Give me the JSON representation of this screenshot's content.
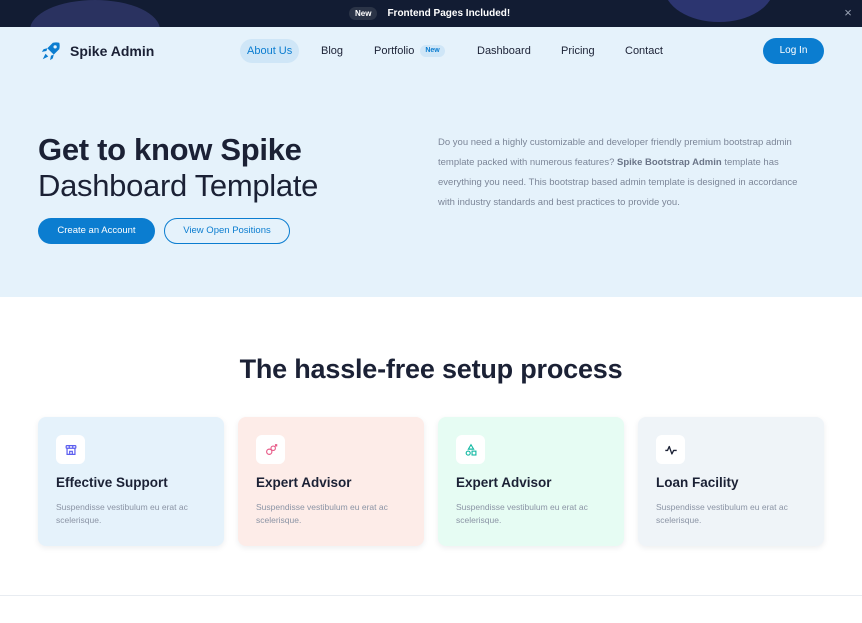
{
  "announcement": {
    "badge": "New",
    "message": "Frontend Pages Included!",
    "close_icon": "×"
  },
  "brand": {
    "name": "Spike Admin",
    "icon": "rocket-icon",
    "color": "#0b7dd0"
  },
  "nav": {
    "items": [
      {
        "label": "About Us",
        "active": true
      },
      {
        "label": "Blog"
      },
      {
        "label": "Portfolio",
        "badge": "New"
      },
      {
        "label": "Dashboard"
      },
      {
        "label": "Pricing"
      },
      {
        "label": "Contact"
      }
    ],
    "login_label": "Log In"
  },
  "hero": {
    "title_line1": "Get to know Spike",
    "title_line2": "Dashboard Template",
    "primary_button": "Create an Account",
    "secondary_button": "View Open Positions",
    "desc_part1": "Do you need a highly customizable and developer friendly premium bootstrap admin template packed with numerous features? ",
    "desc_bold": "Spike Bootstrap Admin",
    "desc_part2": " template has everything you need. This bootstrap based admin template is designed in accordance with industry standards and best practices to provide you."
  },
  "section": {
    "title": "The hassle-free setup process",
    "cards": [
      {
        "title": "Effective Support",
        "desc": "Suspendisse vestibulum eu erat ac scelerisque.",
        "icon": "store-icon",
        "bg": "#e5f2fb",
        "icon_color": "#5d5fef"
      },
      {
        "title": "Expert Advisor",
        "desc": "Suspendisse vestibulum eu erat ac scelerisque.",
        "icon": "gender-icon",
        "bg": "#fdece8",
        "icon_color": "#e85d8a"
      },
      {
        "title": "Expert Advisor",
        "desc": "Suspendisse vestibulum eu erat ac scelerisque.",
        "icon": "shapes-icon",
        "bg": "#e6fcf3",
        "icon_color": "#13b9a3"
      },
      {
        "title": "Loan Facility",
        "desc": "Suspendisse vestibulum eu erat ac scelerisque.",
        "icon": "activity-icon",
        "bg": "#eff4f8",
        "icon_color": "#1b2135"
      }
    ]
  }
}
